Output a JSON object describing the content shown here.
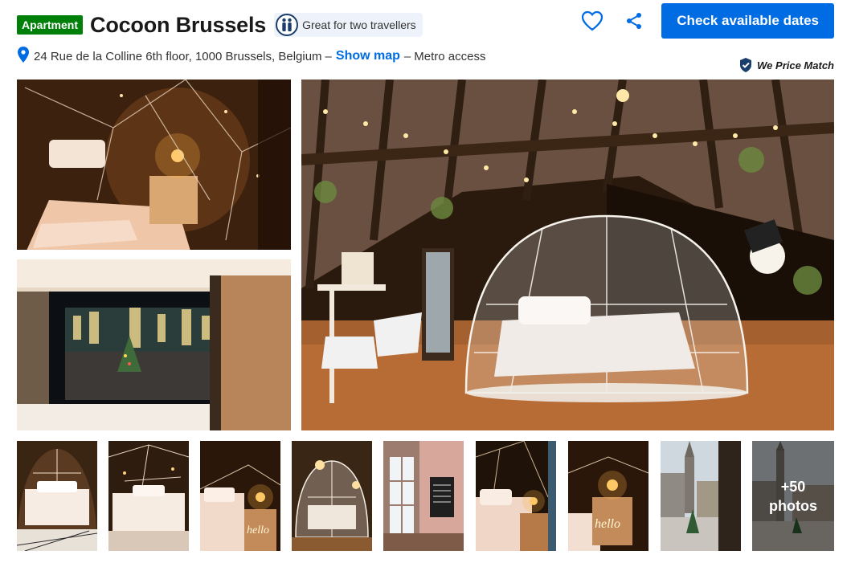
{
  "header": {
    "badge": "Apartment",
    "title": "Cocoon Brussels",
    "traveller_tag": "Great for two travellers",
    "cta_label": "Check available dates",
    "icons": {
      "traveller": "two-people-icon",
      "favorite": "heart-icon",
      "share": "share-icon"
    }
  },
  "address": {
    "text": "24 Rue de la Colline 6th floor, 1000 Brussels, Belgium",
    "dash1": "–",
    "show_map": "Show map",
    "dash2": "–",
    "extra": "Metro access"
  },
  "price_match": "We Price Match",
  "gallery": {
    "main": [
      {
        "label": "dome-bedroom-closeup"
      },
      {
        "label": "window-grand-place-view"
      },
      {
        "label": "attic-dome-overview"
      }
    ],
    "thumbnails": [
      {
        "label": "dome-bed-front"
      },
      {
        "label": "dome-bed-lights"
      },
      {
        "label": "bedside-lamp-hello"
      },
      {
        "label": "dome-exterior"
      },
      {
        "label": "window-wall-sign"
      },
      {
        "label": "bed-lamp-side"
      },
      {
        "label": "hello-neon-lamp"
      },
      {
        "label": "grand-place-christmas"
      },
      {
        "label": "grand-place-square"
      }
    ],
    "more_count": "+50",
    "more_label": "photos"
  },
  "colors": {
    "accent": "#006ce4",
    "badge": "#008009",
    "pill_bg": "#eef3fb"
  }
}
